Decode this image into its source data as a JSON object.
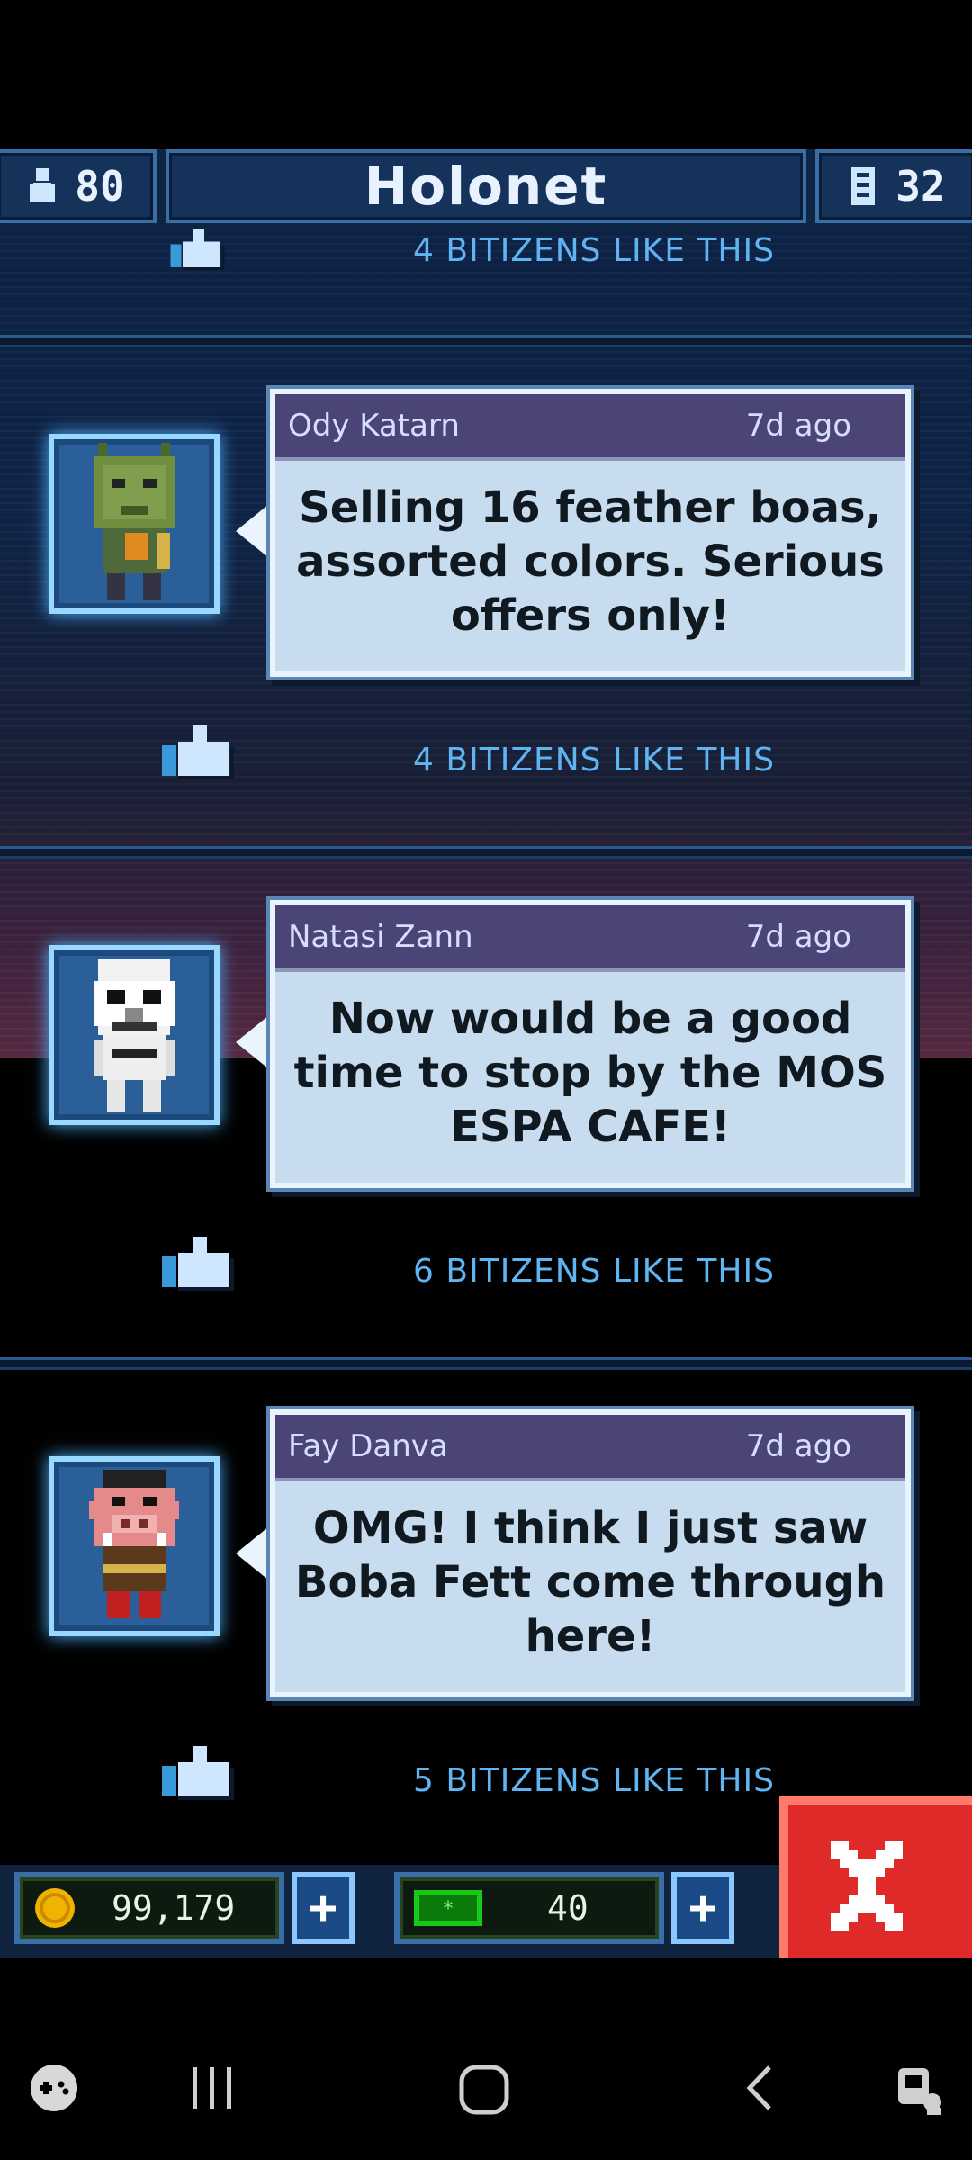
{
  "header": {
    "population": "80",
    "title": "Holonet",
    "floors": "32"
  },
  "feed": {
    "top_likes": "4 BITIZENS LIKE THIS",
    "posts": [
      {
        "author": "Ody Katarn",
        "time": "7d ago",
        "message": "Selling 16 feather boas, assorted colors. Serious offers only!",
        "likes": "4 BITIZENS LIKE THIS",
        "avatar": "alien-bitizen"
      },
      {
        "author": "Natasi Zann",
        "time": "7d ago",
        "message": "Now would be a good time to stop by the MOS ESPA CAFE!",
        "likes": "6 BITIZENS LIKE THIS",
        "avatar": "stormtrooper-bitizen"
      },
      {
        "author": "Fay Danva",
        "time": "7d ago",
        "message": "OMG! I think I just saw Boba Fett come through here!",
        "likes": "5 BITIZENS LIKE THIS",
        "avatar": "gamorrean-bitizen"
      }
    ]
  },
  "resources": {
    "coins": "99,179",
    "bux": "40"
  },
  "icons": {
    "population": "person-icon",
    "floors": "building-icon",
    "like": "thumbs-up-icon",
    "coin": "coin-icon",
    "bux": "bux-icon",
    "plus": "plus-icon",
    "close": "close-icon"
  },
  "colors": {
    "accent": "#5fb4f2",
    "bubble_header": "#4a4477",
    "close": "#e02a2a"
  }
}
